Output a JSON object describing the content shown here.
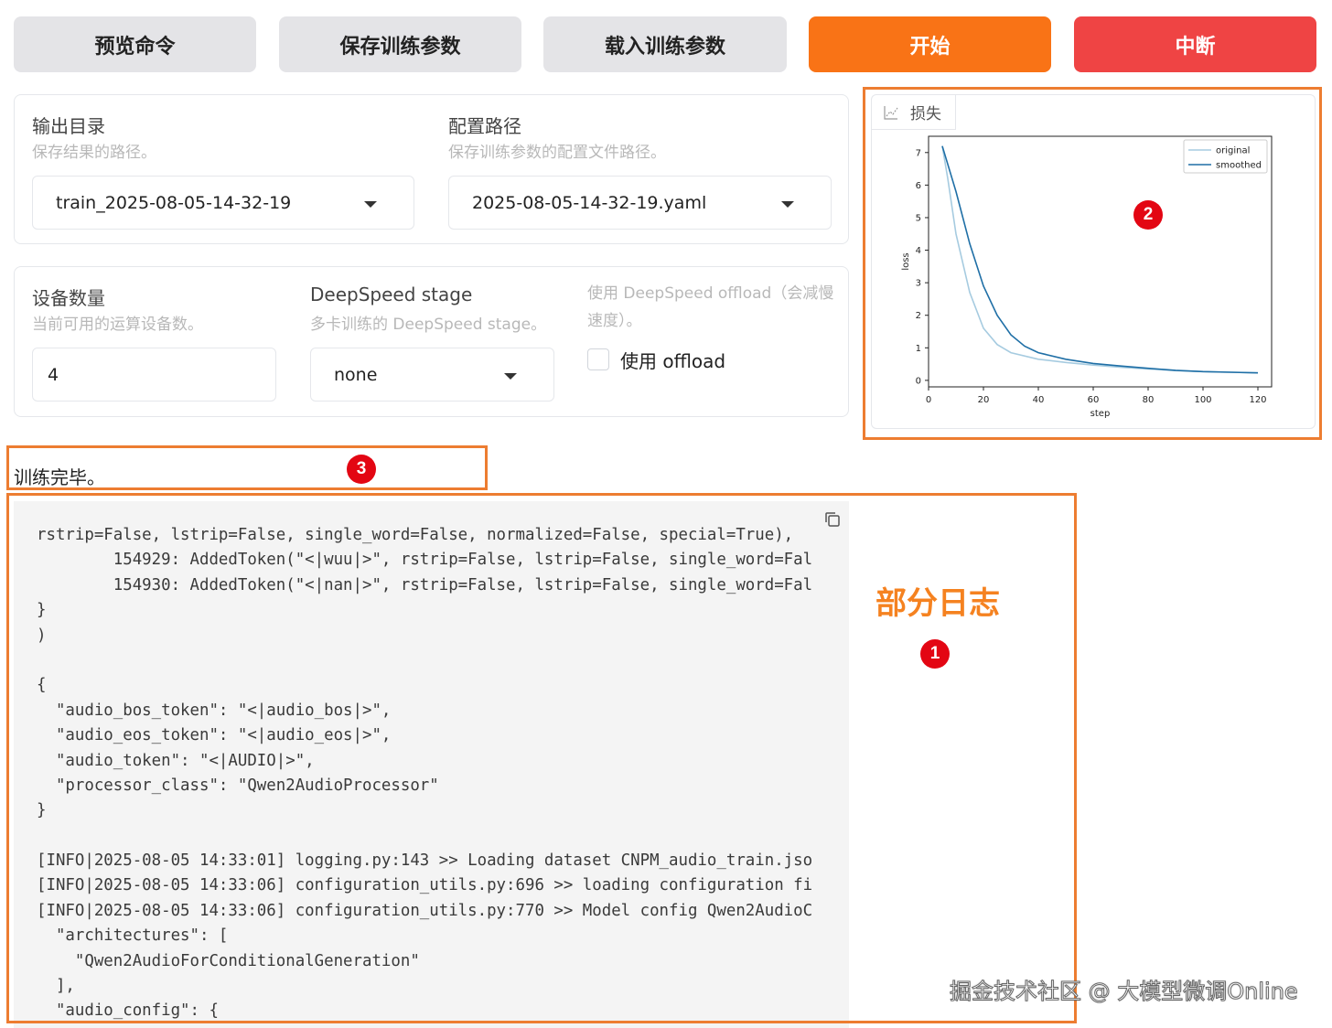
{
  "toolbar": {
    "preview_label": "预览命令",
    "save_label": "保存训练参数",
    "load_label": "载入训练参数",
    "start_label": "开始",
    "abort_label": "中断"
  },
  "output": {
    "output_dir": {
      "label": "输出目录",
      "info": "保存结果的路径。",
      "value": "train_2025-08-05-14-32-19"
    },
    "config_path": {
      "label": "配置路径",
      "info": "保存训练参数的配置文件路径。",
      "value": "2025-08-05-14-32-19.yaml"
    }
  },
  "devices": {
    "device_count": {
      "label": "设备数量",
      "info": "当前可用的运算设备数。",
      "value": "4"
    },
    "ds_stage": {
      "label": "DeepSpeed stage",
      "info": "多卡训练的 DeepSpeed stage。",
      "value": "none"
    },
    "ds_offload": {
      "label_line1": "使用 DeepSpeed offload（会减慢",
      "label_line2": "速度）。",
      "checkbox_label": "使用 offload",
      "checked": false
    }
  },
  "status": {
    "text": "训练完毕。"
  },
  "log": {
    "lines": [
      "rstrip=False, lstrip=False, single_word=False, normalized=False, special=True),",
      "        154929: AddedToken(\"<|wuu|>\", rstrip=False, lstrip=False, single_word=Fal",
      "        154930: AddedToken(\"<|nan|>\", rstrip=False, lstrip=False, single_word=Fal",
      "}",
      ")",
      "",
      "{",
      "  \"audio_bos_token\": \"<|audio_bos|>\",",
      "  \"audio_eos_token\": \"<|audio_eos|>\",",
      "  \"audio_token\": \"<|AUDIO|>\",",
      "  \"processor_class\": \"Qwen2AudioProcessor\"",
      "}",
      "",
      "[INFO|2025-08-05 14:33:01] logging.py:143 >> Loading dataset CNPM_audio_train.jso",
      "[INFO|2025-08-05 14:33:06] configuration_utils.py:696 >> loading configuration fi",
      "[INFO|2025-08-05 14:33:06] configuration_utils.py:770 >> Model config Qwen2AudioC",
      "  \"architectures\": [",
      "    \"Qwen2AudioForConditionalGeneration\"",
      "  ],",
      "  \"audio_config\": {"
    ]
  },
  "annotations": {
    "log_label": "部分日志",
    "badge1": "1",
    "badge2": "2",
    "badge3": "3",
    "color": "#ed7d31",
    "badge_color": "#e30613"
  },
  "watermark": "掘金技术社区 @ 大模型微调Online",
  "colors": {
    "start": "#f97316",
    "abort": "#ef4444",
    "neutral_button": "#e4e4e7"
  },
  "chart_panel": {
    "tab_label": "损失",
    "icon": "chart-icon"
  },
  "chart_data": {
    "type": "line",
    "xlabel": "step",
    "ylabel": "loss",
    "xlim": [
      0,
      125
    ],
    "ylim": [
      -0.2,
      7.5
    ],
    "xticks": [
      0,
      20,
      40,
      60,
      80,
      100,
      120
    ],
    "yticks": [
      0,
      1,
      2,
      3,
      4,
      5,
      6,
      7
    ],
    "legend_position": "top-right",
    "series": [
      {
        "name": "original",
        "color": "#a6cbe0",
        "x": [
          5,
          7,
          10,
          15,
          20,
          25,
          30,
          40,
          50,
          60,
          70,
          80,
          90,
          100,
          110,
          120
        ],
        "y": [
          7.2,
          6.2,
          4.5,
          2.7,
          1.6,
          1.1,
          0.85,
          0.65,
          0.55,
          0.47,
          0.4,
          0.35,
          0.3,
          0.27,
          0.25,
          0.23
        ]
      },
      {
        "name": "smoothed",
        "color": "#1f6fa6",
        "x": [
          5,
          10,
          15,
          20,
          25,
          30,
          35,
          40,
          50,
          60,
          70,
          80,
          90,
          100,
          110,
          120
        ],
        "y": [
          7.2,
          5.8,
          4.2,
          2.9,
          2.0,
          1.4,
          1.05,
          0.85,
          0.65,
          0.52,
          0.44,
          0.37,
          0.31,
          0.27,
          0.25,
          0.23
        ]
      }
    ]
  }
}
